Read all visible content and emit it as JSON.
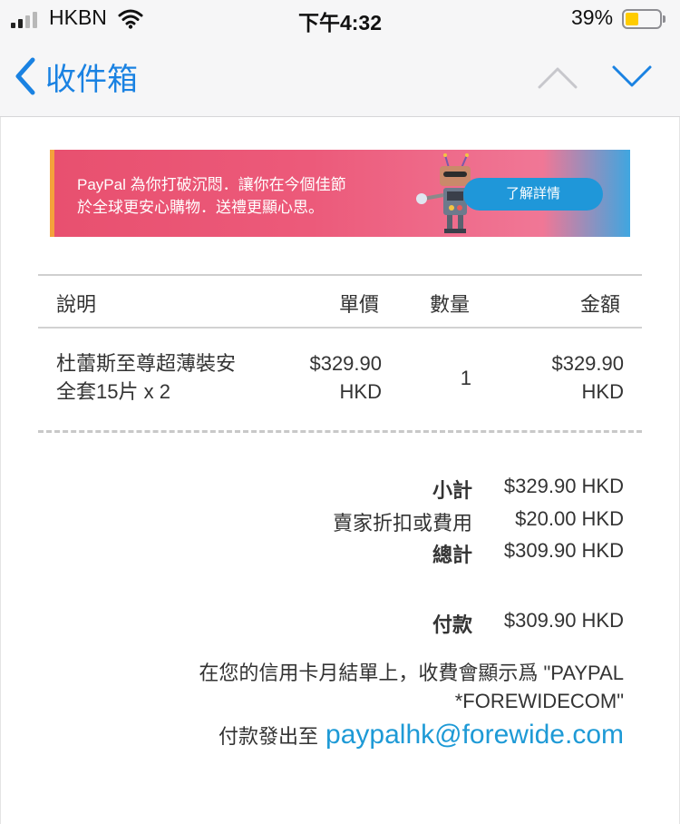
{
  "status": {
    "carrier": "HKBN",
    "time": "下午4:32",
    "battery": "39%",
    "battery_level": 0.39
  },
  "nav": {
    "back_label": "收件箱",
    "icons": [
      "chevron-left-icon",
      "chevron-up-icon",
      "chevron-down-icon"
    ]
  },
  "banner": {
    "line1": "PayPal 為你打破沉悶．讓你在今個佳節",
    "line2": "於全球更安心購物．送禮更顯心思。",
    "button": "了解詳情"
  },
  "table": {
    "headers": [
      "說明",
      "單價",
      "數量",
      "金額"
    ],
    "rows": [
      {
        "desc_line1": "杜蕾斯至尊超薄裝安",
        "desc_line2": "全套15片 x 2",
        "unit_line1": "$329.90",
        "unit_line2": "HKD",
        "qty": "1",
        "amt_line1": "$329.90",
        "amt_line2": "HKD"
      }
    ]
  },
  "summary": {
    "subtotal_label": "小計",
    "subtotal": "$329.90 HKD",
    "discount_label": "賣家折扣或費用",
    "discount": "$20.00 HKD",
    "total_label": "總計",
    "total": "$309.90 HKD",
    "payment_label": "付款",
    "payment": "$309.90 HKD"
  },
  "note": {
    "line1": "在您的信用卡月結單上，收費會顯示爲 \"PAYPAL",
    "line2": "*FOREWIDECOM\"",
    "sent_label": "付款發出至",
    "email": "paypalhk@forewide.com"
  },
  "colors": {
    "link": "#1a82e2",
    "email": "#1e9ad6",
    "banner_pink": "#e8506f",
    "banner_button": "#1f97d9"
  }
}
